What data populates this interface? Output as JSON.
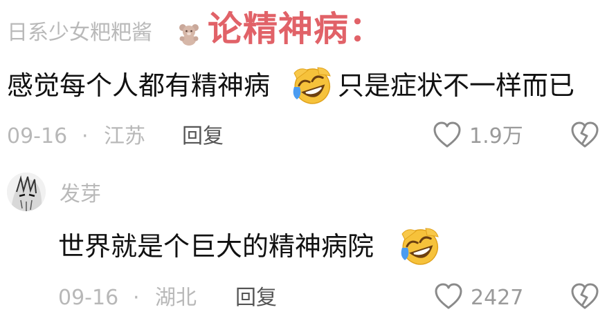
{
  "overlay": {
    "title": "论精神病："
  },
  "comments": [
    {
      "username": "日系少女粑粑酱",
      "username_icon": "teddy-bear-icon",
      "text_before_emoji": "感觉每个人都有精神病",
      "emoji": "rolling-laughing-emoji",
      "text_after_emoji": "只是症状不一样而已",
      "date": "09-16",
      "separator": "·",
      "location": "江苏",
      "reply_label": "回复",
      "like_count": "1.9万"
    },
    {
      "username": "发芽",
      "avatar": "anime-avatar",
      "text": "世界就是个巨大的精神病院",
      "emoji": "rolling-laughing-emoji",
      "date": "09-16",
      "separator": "·",
      "location": "湖北",
      "reply_label": "回复",
      "like_count": "2427"
    }
  ],
  "colors": {
    "overlay_title": "#e16268",
    "muted_text": "#b8b8b8",
    "main_text": "#111111",
    "icon_gray": "#8a8a8a"
  }
}
